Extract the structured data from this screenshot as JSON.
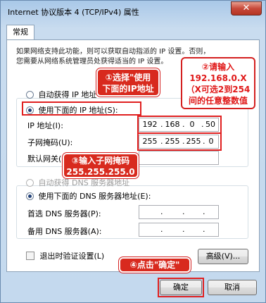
{
  "window": {
    "title": "Internet 协议版本 4 (TCP/IPv4) 属性",
    "close_glyph": "✕"
  },
  "tab": {
    "label": "常规"
  },
  "description": {
    "line1": "如果网络支持此功能，则可以获取自动指派的 IP 设置。否则，",
    "line2": "您需要从网络系统管理员处获得适当的 IP 设置。"
  },
  "ip": {
    "auto_label": "自动获得 IP 地址",
    "manual_label": "使用下面的 IP 地址(S):",
    "address_label": "IP 地址(I):",
    "address_octets": [
      "192",
      "168",
      "0",
      "50"
    ],
    "mask_label": "子网掩码(U):",
    "mask_octets": [
      "255",
      "255",
      "255",
      "0"
    ],
    "gateway_label": "默认网关(D):",
    "mode": "manual"
  },
  "dns": {
    "auto_label": "自动获得 DNS 服务器地址",
    "manual_label": "使用下面的 DNS 服务器地址(E):",
    "preferred_label": "首选 DNS 服务器(P):",
    "alternate_label": "备用 DNS 服务器(A):",
    "mode": "manual"
  },
  "validate": {
    "label": "退出时验证设置(L)",
    "checked": false
  },
  "buttons": {
    "advanced": "高级(V)...",
    "ok": "确定",
    "cancel": "取消"
  },
  "annotations": {
    "step1_line1": "①选择\"使用",
    "step1_line2": "下面的IP地址",
    "step2_line1": "②请输入",
    "step2_line2": "192.168.0.X",
    "step2_line3": "（X可选2到254",
    "step2_line4": "间的任意整数值",
    "step3_line1": "③输入子网掩码",
    "step3_line2": "255.255.255.0",
    "step4": "④点击\"确定\""
  },
  "colors": {
    "annotation_red": "#e01818",
    "selected_radio": "#1f3f77"
  },
  "icons": {
    "close": "close-icon",
    "radio": "radio-button",
    "checkbox": "checkbox"
  }
}
